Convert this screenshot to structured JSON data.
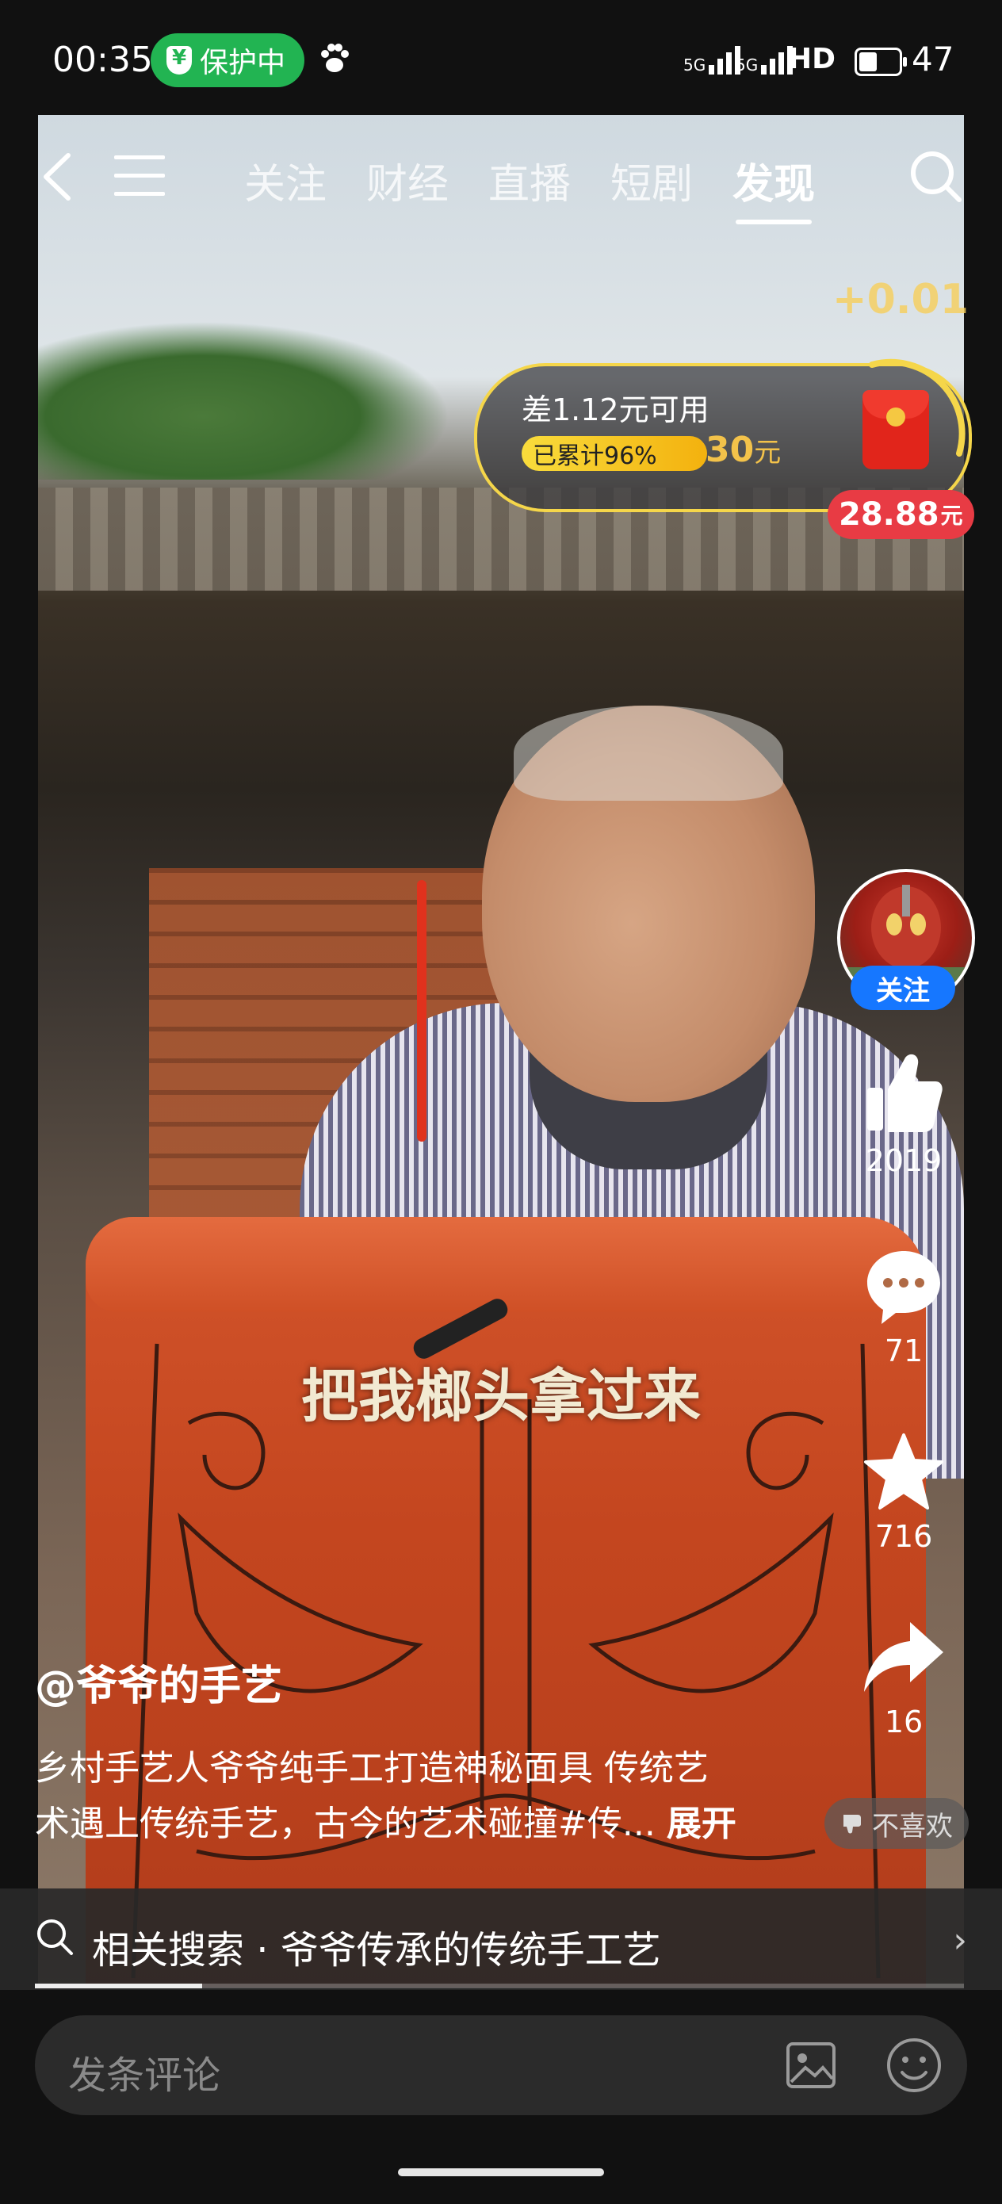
{
  "status_bar": {
    "time": "00:35",
    "protection_label": "保护中",
    "signal1": "5G",
    "signal2": "5G",
    "hd_label": "HD",
    "battery": "47"
  },
  "nav": {
    "tabs": [
      {
        "label": "关注"
      },
      {
        "label": "财经"
      },
      {
        "label": "直播"
      },
      {
        "label": "短剧"
      },
      {
        "label": "发现",
        "active": true
      }
    ]
  },
  "reward": {
    "bonus": "+0.01",
    "hint": "差1.12元可用",
    "progress_label": "已累计96%",
    "progress_percent": 96,
    "target_amount": "30",
    "target_unit": "元",
    "cash_amount": "28.88",
    "cash_unit": "元"
  },
  "video": {
    "subtitle": "把我榔头拿过来",
    "playback_progress": 0.18
  },
  "actions": {
    "follow_label": "关注",
    "likes": "2019",
    "comments": "71",
    "favorites": "716",
    "shares": "16"
  },
  "post": {
    "author": "@爷爷的手艺",
    "description_line1": "乡村手艺人爷爷纯手工打造神秘面具 传统艺",
    "description_line2": "术遇上传统手艺，古今的艺术碰撞#传...",
    "expand_label": "展开",
    "dislike_label": "不喜欢"
  },
  "related_search": {
    "text": "相关搜索 · 爷爷传承的传统手工艺"
  },
  "comment_bar": {
    "placeholder": "发条评论"
  },
  "colors": {
    "follow_blue": "#1677ff",
    "cash_red": "#e83b44",
    "gold": "#f5d64a",
    "protect_green": "#22b452"
  }
}
